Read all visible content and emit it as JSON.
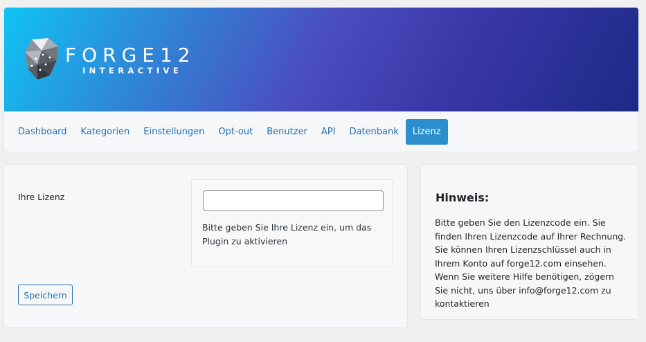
{
  "brand": {
    "name": "FORGE12",
    "subtitle": "INTERACTIVE",
    "gradient_colors": [
      "#0fc4f4",
      "#4a4fc0",
      "#1b2a86"
    ]
  },
  "nav": {
    "items": [
      {
        "label": "Dashboard",
        "active": false
      },
      {
        "label": "Kategorien",
        "active": false
      },
      {
        "label": "Einstellungen",
        "active": false
      },
      {
        "label": "Opt-out",
        "active": false
      },
      {
        "label": "Benutzer",
        "active": false
      },
      {
        "label": "API",
        "active": false
      },
      {
        "label": "Datenbank",
        "active": false
      },
      {
        "label": "Lizenz",
        "active": true
      }
    ],
    "active_color": "#2b8fcd"
  },
  "form": {
    "license_label": "Ihre Lizenz",
    "license_value": "",
    "license_help": "Bitte geben Sie Ihre Lizenz ein, um das Plugin zu aktivieren",
    "save_label": "Speichern"
  },
  "sidebar": {
    "title": "Hinweis:",
    "text": "Bitte geben Sie den Lizenzcode ein. Sie finden Ihren Lizenzcode auf Ihrer Rechnung. Sie können Ihren Lizenzschlüssel auch in Ihrem Konto auf forge12.com einsehen. Wenn Sie weitere Hilfe benötigen, zögern Sie nicht, uns über info@forge12.com zu kontaktieren"
  }
}
